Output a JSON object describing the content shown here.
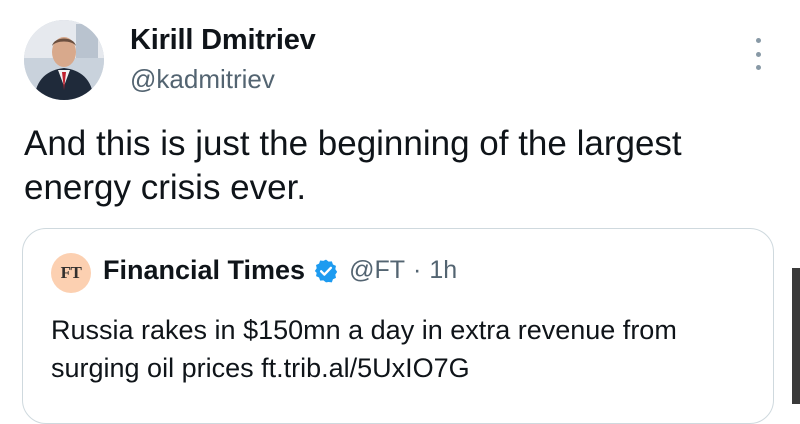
{
  "author": {
    "name": "Kirill Dmitriev",
    "handle": "@kadmitriev"
  },
  "tweet": {
    "text": "And this is just the beginning of the largest energy crisis ever."
  },
  "quoted_tweet": {
    "logo_text": "FT",
    "name": "Financial Times",
    "verified": true,
    "handle": "@FT",
    "separator": "·",
    "time": "1h",
    "text": "Russia rakes in $150mn a day in extra revenue from surging oil prices ft.trib.al/5UxIO7G"
  },
  "icons": {
    "more": "more-vertical-icon",
    "verified": "verified-badge-icon"
  },
  "colors": {
    "text": "#0f1419",
    "secondary": "#536471",
    "verified": "#1d9bf0",
    "ft_logo_bg": "#fcd0b1",
    "border": "#cfd9de"
  }
}
